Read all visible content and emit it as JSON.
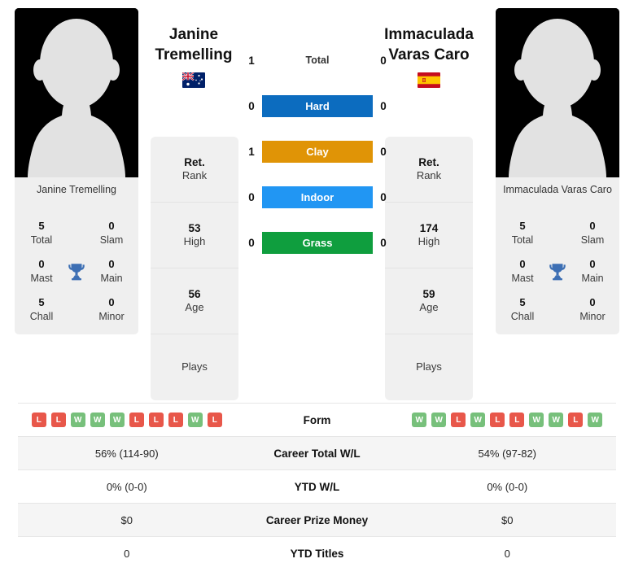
{
  "players": {
    "left": {
      "name": "Janine Tremelling",
      "name_line1": "Janine",
      "name_line2": "Tremelling",
      "flag": "australia",
      "flag_alt": "Australia flag",
      "caption": "Janine Tremelling",
      "titles": {
        "total": "5",
        "total_label": "Total",
        "slam": "0",
        "slam_label": "Slam",
        "mast": "0",
        "mast_label": "Mast",
        "main": "0",
        "main_label": "Main",
        "chall": "5",
        "chall_label": "Chall",
        "minor": "0",
        "minor_label": "Minor"
      },
      "ranks": [
        {
          "value": "Ret.",
          "label": "Rank"
        },
        {
          "value": "53",
          "label": "High"
        },
        {
          "value": "56",
          "label": "Age"
        },
        {
          "value": "",
          "label": "Plays"
        }
      ],
      "form": [
        "L",
        "L",
        "W",
        "W",
        "W",
        "L",
        "L",
        "L",
        "W",
        "L"
      ],
      "career_total_wl": "56% (114-90)",
      "ytd_wl": "0% (0-0)",
      "career_prize_money": "$0",
      "ytd_titles": "0"
    },
    "right": {
      "name": "Immaculada Varas Caro",
      "name_line1": "Immaculada",
      "name_line2": "Varas Caro",
      "flag": "spain",
      "flag_alt": "Spain flag",
      "caption": "Immaculada Varas Caro",
      "titles": {
        "total": "5",
        "total_label": "Total",
        "slam": "0",
        "slam_label": "Slam",
        "mast": "0",
        "mast_label": "Mast",
        "main": "0",
        "main_label": "Main",
        "chall": "5",
        "chall_label": "Chall",
        "minor": "0",
        "minor_label": "Minor"
      },
      "ranks": [
        {
          "value": "Ret.",
          "label": "Rank"
        },
        {
          "value": "174",
          "label": "High"
        },
        {
          "value": "59",
          "label": "Age"
        },
        {
          "value": "",
          "label": "Plays"
        }
      ],
      "form": [
        "W",
        "W",
        "L",
        "W",
        "L",
        "L",
        "W",
        "W",
        "L",
        "W"
      ],
      "career_total_wl": "54% (97-82)",
      "ytd_wl": "0% (0-0)",
      "career_prize_money": "$0",
      "ytd_titles": "0"
    }
  },
  "surfaces": [
    {
      "name": "Total",
      "left": "1",
      "right": "0",
      "color": "transparent",
      "plain": true
    },
    {
      "name": "Hard",
      "left": "0",
      "right": "0",
      "color": "#0c6cbf"
    },
    {
      "name": "Clay",
      "left": "1",
      "right": "0",
      "color": "#e09406"
    },
    {
      "name": "Indoor",
      "left": "0",
      "right": "0",
      "color": "#2196f3"
    },
    {
      "name": "Grass",
      "left": "0",
      "right": "0",
      "color": "#0f9e3e"
    }
  ],
  "table_rows": [
    {
      "label": "Form",
      "type": "form"
    },
    {
      "label": "Career Total W/L",
      "type": "text",
      "key": "career_total_wl"
    },
    {
      "label": "YTD W/L",
      "type": "text",
      "key": "ytd_wl"
    },
    {
      "label": "Career Prize Money",
      "type": "text",
      "key": "career_prize_money"
    },
    {
      "label": "YTD Titles",
      "type": "text",
      "key": "ytd_titles"
    }
  ],
  "colors": {
    "win": "#77c07b",
    "loss": "#e8574a",
    "trophy": "#3d6fb4",
    "card_bg": "#f0f0f0"
  }
}
